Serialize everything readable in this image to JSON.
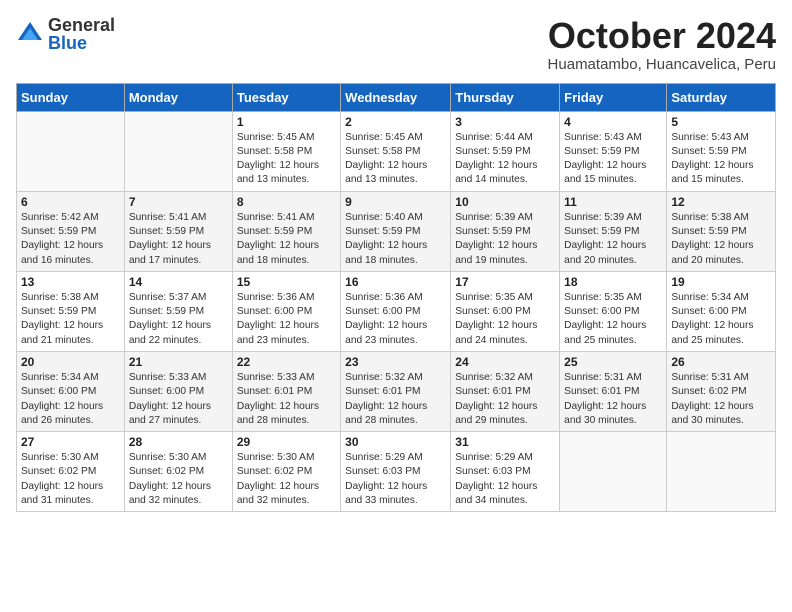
{
  "logo": {
    "general": "General",
    "blue": "Blue"
  },
  "title": "October 2024",
  "location": "Huamatambo, Huancavelica, Peru",
  "days_of_week": [
    "Sunday",
    "Monday",
    "Tuesday",
    "Wednesday",
    "Thursday",
    "Friday",
    "Saturday"
  ],
  "weeks": [
    [
      {
        "day": "",
        "info": ""
      },
      {
        "day": "",
        "info": ""
      },
      {
        "day": "1",
        "info": "Sunrise: 5:45 AM\nSunset: 5:58 PM\nDaylight: 12 hours and 13 minutes."
      },
      {
        "day": "2",
        "info": "Sunrise: 5:45 AM\nSunset: 5:58 PM\nDaylight: 12 hours and 13 minutes."
      },
      {
        "day": "3",
        "info": "Sunrise: 5:44 AM\nSunset: 5:59 PM\nDaylight: 12 hours and 14 minutes."
      },
      {
        "day": "4",
        "info": "Sunrise: 5:43 AM\nSunset: 5:59 PM\nDaylight: 12 hours and 15 minutes."
      },
      {
        "day": "5",
        "info": "Sunrise: 5:43 AM\nSunset: 5:59 PM\nDaylight: 12 hours and 15 minutes."
      }
    ],
    [
      {
        "day": "6",
        "info": "Sunrise: 5:42 AM\nSunset: 5:59 PM\nDaylight: 12 hours and 16 minutes."
      },
      {
        "day": "7",
        "info": "Sunrise: 5:41 AM\nSunset: 5:59 PM\nDaylight: 12 hours and 17 minutes."
      },
      {
        "day": "8",
        "info": "Sunrise: 5:41 AM\nSunset: 5:59 PM\nDaylight: 12 hours and 18 minutes."
      },
      {
        "day": "9",
        "info": "Sunrise: 5:40 AM\nSunset: 5:59 PM\nDaylight: 12 hours and 18 minutes."
      },
      {
        "day": "10",
        "info": "Sunrise: 5:39 AM\nSunset: 5:59 PM\nDaylight: 12 hours and 19 minutes."
      },
      {
        "day": "11",
        "info": "Sunrise: 5:39 AM\nSunset: 5:59 PM\nDaylight: 12 hours and 20 minutes."
      },
      {
        "day": "12",
        "info": "Sunrise: 5:38 AM\nSunset: 5:59 PM\nDaylight: 12 hours and 20 minutes."
      }
    ],
    [
      {
        "day": "13",
        "info": "Sunrise: 5:38 AM\nSunset: 5:59 PM\nDaylight: 12 hours and 21 minutes."
      },
      {
        "day": "14",
        "info": "Sunrise: 5:37 AM\nSunset: 5:59 PM\nDaylight: 12 hours and 22 minutes."
      },
      {
        "day": "15",
        "info": "Sunrise: 5:36 AM\nSunset: 6:00 PM\nDaylight: 12 hours and 23 minutes."
      },
      {
        "day": "16",
        "info": "Sunrise: 5:36 AM\nSunset: 6:00 PM\nDaylight: 12 hours and 23 minutes."
      },
      {
        "day": "17",
        "info": "Sunrise: 5:35 AM\nSunset: 6:00 PM\nDaylight: 12 hours and 24 minutes."
      },
      {
        "day": "18",
        "info": "Sunrise: 5:35 AM\nSunset: 6:00 PM\nDaylight: 12 hours and 25 minutes."
      },
      {
        "day": "19",
        "info": "Sunrise: 5:34 AM\nSunset: 6:00 PM\nDaylight: 12 hours and 25 minutes."
      }
    ],
    [
      {
        "day": "20",
        "info": "Sunrise: 5:34 AM\nSunset: 6:00 PM\nDaylight: 12 hours and 26 minutes."
      },
      {
        "day": "21",
        "info": "Sunrise: 5:33 AM\nSunset: 6:00 PM\nDaylight: 12 hours and 27 minutes."
      },
      {
        "day": "22",
        "info": "Sunrise: 5:33 AM\nSunset: 6:01 PM\nDaylight: 12 hours and 28 minutes."
      },
      {
        "day": "23",
        "info": "Sunrise: 5:32 AM\nSunset: 6:01 PM\nDaylight: 12 hours and 28 minutes."
      },
      {
        "day": "24",
        "info": "Sunrise: 5:32 AM\nSunset: 6:01 PM\nDaylight: 12 hours and 29 minutes."
      },
      {
        "day": "25",
        "info": "Sunrise: 5:31 AM\nSunset: 6:01 PM\nDaylight: 12 hours and 30 minutes."
      },
      {
        "day": "26",
        "info": "Sunrise: 5:31 AM\nSunset: 6:02 PM\nDaylight: 12 hours and 30 minutes."
      }
    ],
    [
      {
        "day": "27",
        "info": "Sunrise: 5:30 AM\nSunset: 6:02 PM\nDaylight: 12 hours and 31 minutes."
      },
      {
        "day": "28",
        "info": "Sunrise: 5:30 AM\nSunset: 6:02 PM\nDaylight: 12 hours and 32 minutes."
      },
      {
        "day": "29",
        "info": "Sunrise: 5:30 AM\nSunset: 6:02 PM\nDaylight: 12 hours and 32 minutes."
      },
      {
        "day": "30",
        "info": "Sunrise: 5:29 AM\nSunset: 6:03 PM\nDaylight: 12 hours and 33 minutes."
      },
      {
        "day": "31",
        "info": "Sunrise: 5:29 AM\nSunset: 6:03 PM\nDaylight: 12 hours and 34 minutes."
      },
      {
        "day": "",
        "info": ""
      },
      {
        "day": "",
        "info": ""
      }
    ]
  ]
}
